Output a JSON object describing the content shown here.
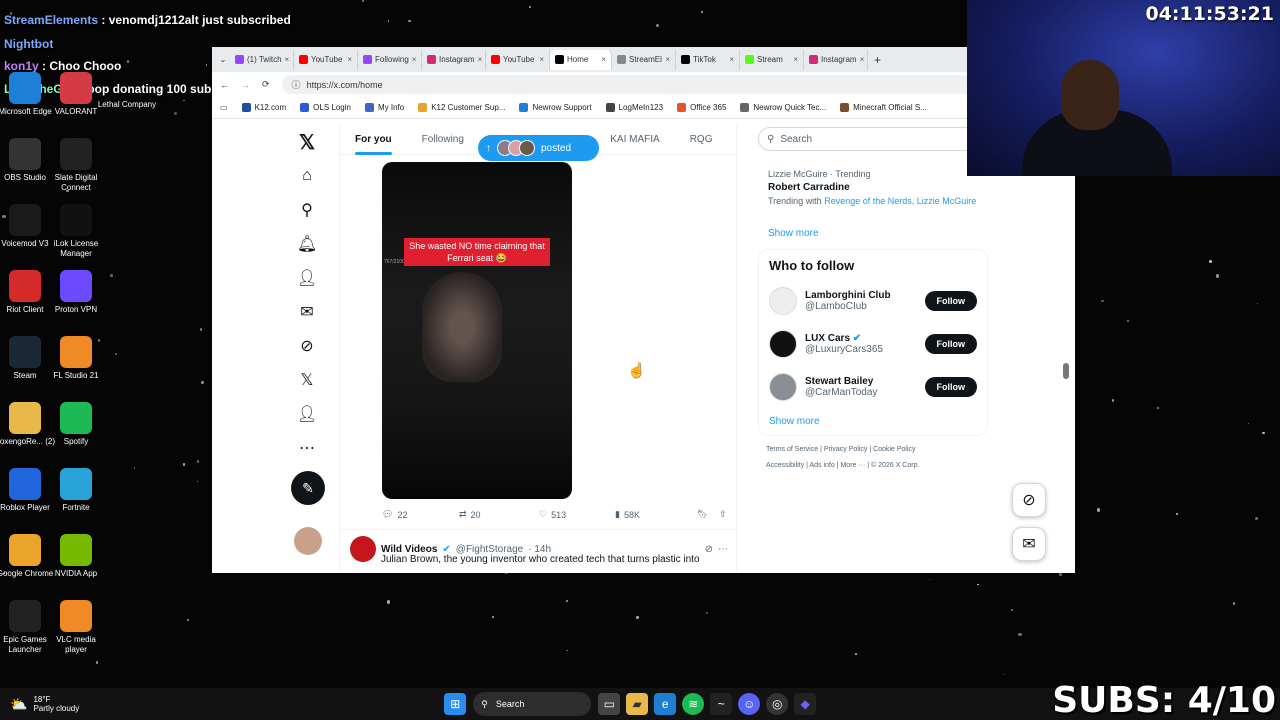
{
  "chat_overlay": [
    {
      "user": "StreamElements",
      "text": ": venomdj1212alt just subscribed"
    },
    {
      "user": "Nightbot",
      "text": ""
    },
    {
      "user": "kon1y",
      "text": ": Choo Chooo"
    },
    {
      "user": "LuciiTheG",
      "text": ": shoop donating 100 subs"
    }
  ],
  "desktop_icons": [
    {
      "label": "Microsoft Edge",
      "icon": "edge-icon",
      "color": "#1d7fd6"
    },
    {
      "label": "VALORANT",
      "icon": "valorant-icon",
      "color": "#d43b45"
    },
    {
      "label": "OBS Studio",
      "icon": "obs-icon",
      "color": "#333333"
    },
    {
      "label": "Slate Digital Connect",
      "icon": "slate-icon",
      "color": "#222222"
    },
    {
      "label": "Voicemod V3",
      "icon": "voicemod-icon",
      "color": "#1a1a1a"
    },
    {
      "label": "iLok License Manager",
      "icon": "ilok-icon",
      "color": "#111111"
    },
    {
      "label": "Riot Client",
      "icon": "riot-icon",
      "color": "#d42a2a"
    },
    {
      "label": "Proton VPN",
      "icon": "proton-icon",
      "color": "#6d4aff"
    },
    {
      "label": "Steam",
      "icon": "steam-icon",
      "color": "#1b2838"
    },
    {
      "label": "FL Studio 21",
      "icon": "flstudio-icon",
      "color": "#f08a24"
    },
    {
      "label": "VoxengoRe... (2)",
      "icon": "folder-icon",
      "color": "#e8b84a"
    },
    {
      "label": "Spotify",
      "icon": "spotify-icon",
      "color": "#1db954"
    },
    {
      "label": "Roblox Player",
      "icon": "roblox-icon",
      "color": "#2266dd"
    },
    {
      "label": "Fortnite",
      "icon": "fortnite-icon",
      "color": "#2aa4d8"
    },
    {
      "label": "Google Chrome",
      "icon": "chrome-icon",
      "color": "#e9a52a"
    },
    {
      "label": "NVIDIA App",
      "icon": "nvidia-icon",
      "color": "#76b900"
    },
    {
      "label": "Epic Games Launcher",
      "icon": "epic-icon",
      "color": "#222222"
    },
    {
      "label": "VLC media player",
      "icon": "vlc-icon",
      "color": "#f08a24"
    }
  ],
  "lethal_company_label": "Lethal Company",
  "browser": {
    "tabs": [
      {
        "label": "(1) Twitch",
        "color": "#9146ff"
      },
      {
        "label": "YouTube",
        "color": "#ff0000"
      },
      {
        "label": "Following",
        "color": "#9146ff"
      },
      {
        "label": "Instagram",
        "color": "#d62976"
      },
      {
        "label": "YouTube",
        "color": "#ff0000"
      },
      {
        "label": "Home",
        "color": "#000000",
        "active": true
      },
      {
        "label": "StreamEl",
        "color": "#888888"
      },
      {
        "label": "TikTok",
        "color": "#000000"
      },
      {
        "label": "Stream",
        "color": "#53fc18"
      },
      {
        "label": "Instagram",
        "color": "#d62976"
      }
    ],
    "url": "https://x.com/home",
    "bookmarks": [
      "K12.com",
      "OLS Login",
      "My Info",
      "K12 Customer Sup...",
      "Newrow Support",
      "LogMeIn123",
      "Office 365",
      "Newrow Quick Tec...",
      "Minecraft Official S..."
    ]
  },
  "x": {
    "feed_tabs": [
      "For you",
      "Following",
      "AMP UNFILTERED",
      "KAI MAFIA",
      "RQG"
    ],
    "posted_label": "posted",
    "video_caption": "She wasted NO time claiming that Ferrari seat 😂",
    "video_counter": "767/21000",
    "actions": {
      "replies": "22",
      "reposts": "20",
      "likes": "513",
      "views": "58K"
    },
    "next_post": {
      "name": "Wild Videos",
      "handle": "@FightStorage",
      "time": "· 14h",
      "text": "Julian Brown, the young inventor who created tech that turns plastic into"
    },
    "search_placeholder": "Search",
    "trend": {
      "context": "Lizzie McGuire · Trending",
      "title": "Robert Carradine",
      "with_label": "Trending with",
      "with_links": "Revenge of the Nerds, Lizzie McGuire",
      "show_more": "Show more"
    },
    "who_to_follow": {
      "title": "Who to follow",
      "accounts": [
        {
          "name": "Lamborghini Club",
          "handle": "@LamboCIub",
          "verified": false,
          "avatar_color": "#eeeeee"
        },
        {
          "name": "LUX Cars",
          "handle": "@LuxuryCars365",
          "verified": true,
          "avatar_color": "#111111"
        },
        {
          "name": "Stewart Bailey",
          "handle": "@CarManToday",
          "verified": false,
          "avatar_color": "#8a8f96"
        }
      ],
      "follow_label": "Follow",
      "show_more": "Show more"
    },
    "footer": [
      "Terms of Service",
      "Privacy Policy",
      "Cookie Policy",
      "Accessibility",
      "Ads info",
      "More ···",
      "© 2026 X Corp."
    ]
  },
  "webcam_timer": "04:11:53:21",
  "weather": {
    "temp": "18°F",
    "condition": "Partly cloudy"
  },
  "taskbar_search": "Search",
  "subs_counter": "SUBS: 4/10"
}
